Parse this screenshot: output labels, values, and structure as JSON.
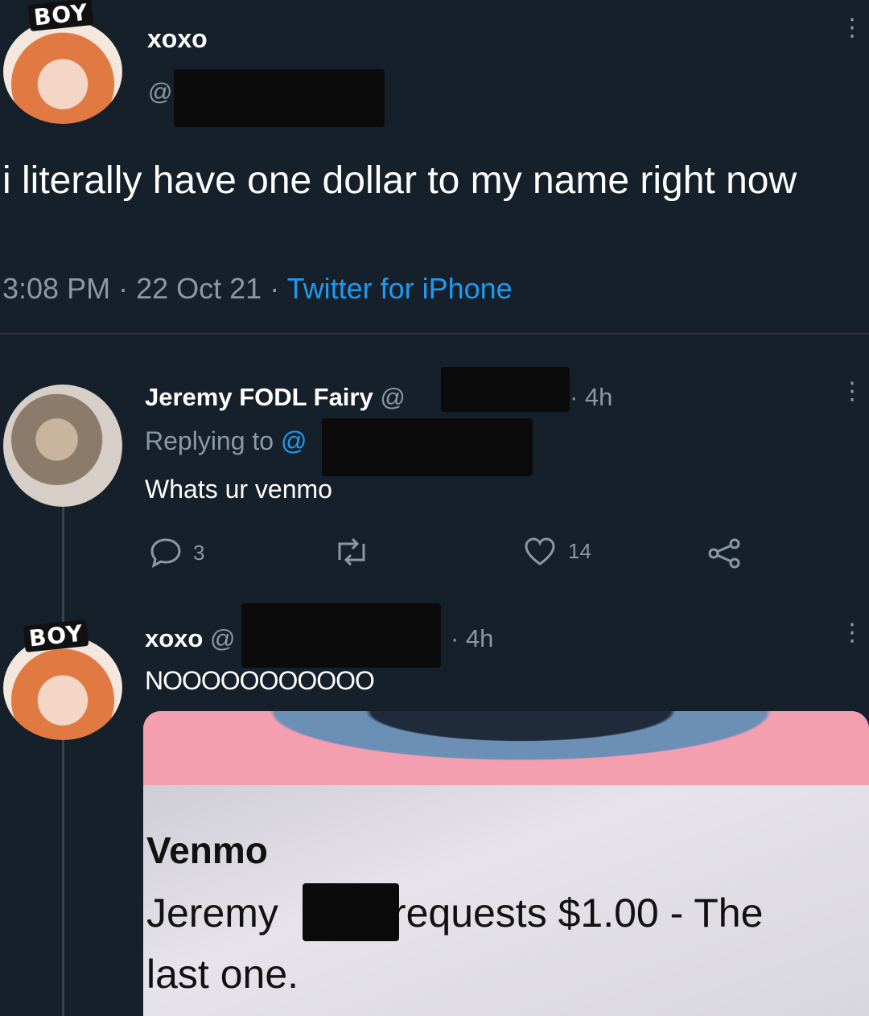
{
  "main_tweet": {
    "avatar_tag": "BOY",
    "display_name": "xoxo",
    "handle_prefix": "@",
    "text": "i literally have one dollar to my name right now",
    "meta_time": "3:08 PM",
    "meta_date": "22 Oct 21",
    "meta_sep": "·",
    "meta_source": "Twitter for iPhone"
  },
  "reply": {
    "display_name": "Jeremy FODL Fairy",
    "handle_prefix": "@",
    "time": "· 4h",
    "replying_to_label": "Replying to",
    "replying_to_handle": "@",
    "text": "Whats ur venmo",
    "actions": {
      "reply_count": "3",
      "like_count": "14"
    }
  },
  "reply2": {
    "avatar_tag": "BOY",
    "display_name": "xoxo",
    "handle_prefix": "@",
    "time": "· 4h",
    "text": "NOOOOOOOOOOO",
    "card": {
      "title": "Venmo",
      "line1_name": "Jeremy",
      "line1_rest": "requests $1.00 - The",
      "line2": "last one."
    }
  },
  "icons": [
    "more-dots-icon",
    "reply-icon",
    "retweet-icon",
    "like-icon",
    "share-icon"
  ],
  "colors": {
    "background": "#15202b",
    "text": "#ffffff",
    "muted": "#8b98a5",
    "link": "#1d9bf0"
  }
}
